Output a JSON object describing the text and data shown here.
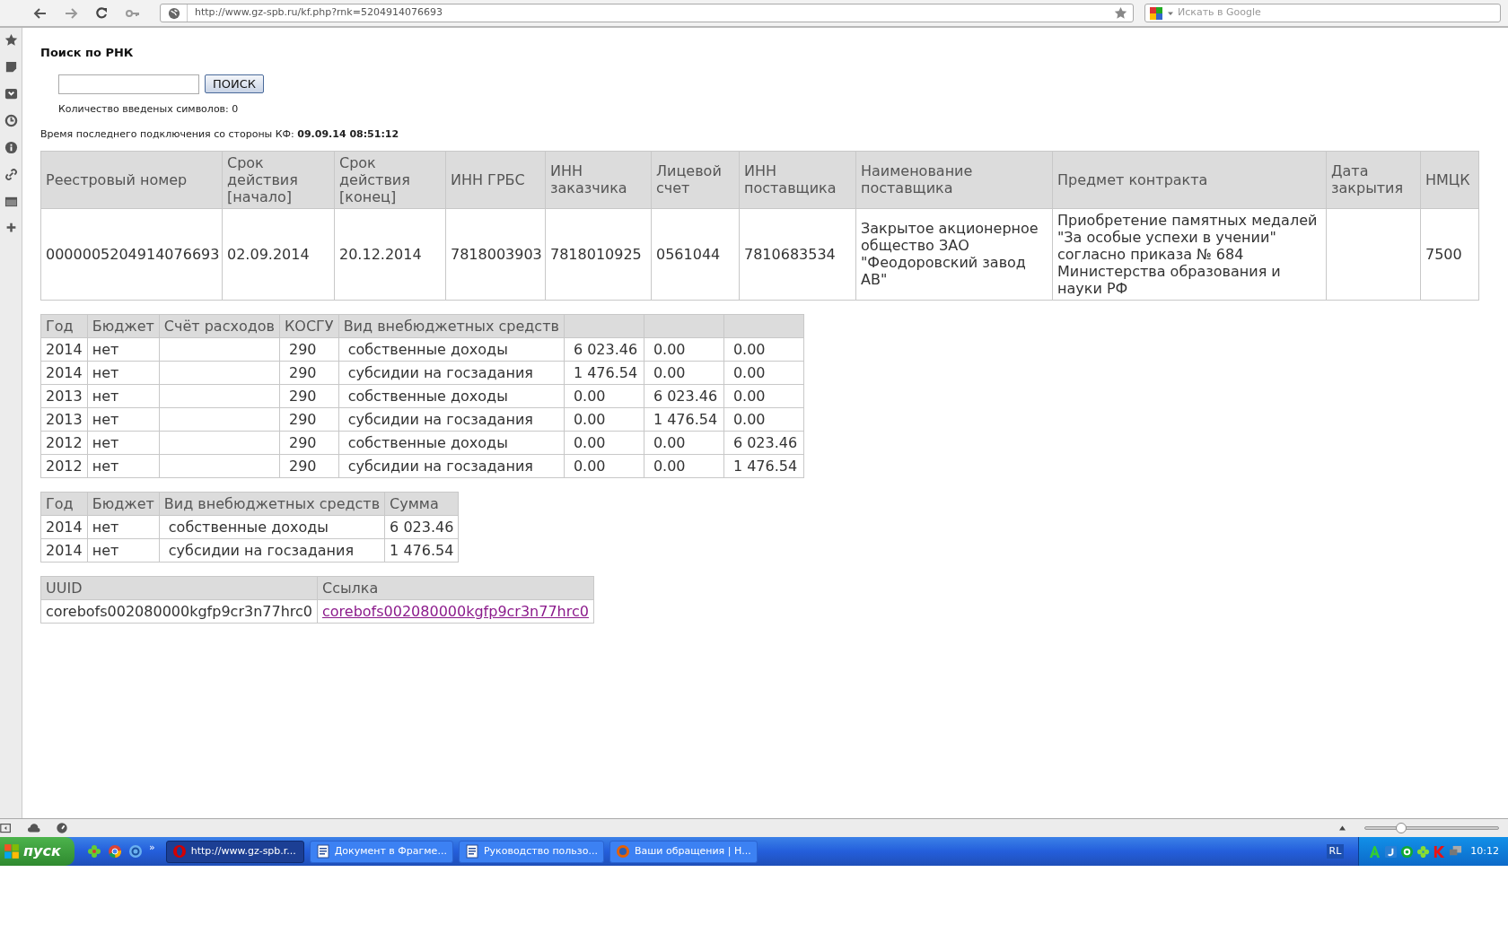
{
  "browser": {
    "url": "http://www.gz-spb.ru/kf.php?rnk=5204914076693",
    "search_placeholder": "Искать в Google",
    "zoom": {
      "level": 0.27
    }
  },
  "page": {
    "title": "Поиск по РНК",
    "search_button": "ПОИСК",
    "char_count": "Количество введеных символов: 0",
    "last_connection_label": "Время последнего подключения со стороны КФ:",
    "last_connection_value": "09.09.14 08:51:12"
  },
  "contract_table": {
    "columns": [
      "Реестровый номер",
      "Срок действия [начало]",
      "Срок действия [конец]",
      "ИНН ГРБС",
      "ИНН заказчика",
      "Лицевой счет",
      "ИНН поставщика",
      "Наименование поставщика",
      "Предмет контракта",
      "Дата закрытия",
      "НМЦК"
    ],
    "row": {
      "registry_number": "0000005204914076693",
      "start": "02.09.2014",
      "end": "20.12.2014",
      "inn_grbs": "7818003903",
      "inn_customer": "7818010925",
      "account": "0561044",
      "inn_supplier": "7810683534",
      "supplier": "Закрытое акционерное общество ЗАО \"Феодоровский завод АВ\"",
      "subject": "Приобретение памятных медалей \"За особые успехи в учении\" согласно приказа № 684 Министерства образования и науки РФ",
      "nmck": "7500"
    }
  },
  "funding_table": {
    "columns": [
      "Год",
      "Бюджет",
      "Счёт расходов",
      "КОСГУ",
      "Вид внебюджетных средств"
    ],
    "rows": [
      {
        "year": "2014",
        "budget": "нет",
        "kosgu": "290",
        "funds": "собственные доходы",
        "values": [
          "6 023.46",
          "0.00",
          "0.00"
        ]
      },
      {
        "year": "2014",
        "budget": "нет",
        "kosgu": "290",
        "funds": "субсидии на госзадания",
        "values": [
          "1 476.54",
          "0.00",
          "0.00"
        ]
      },
      {
        "year": "2013",
        "budget": "нет",
        "kosgu": "290",
        "funds": "собственные доходы",
        "values": [
          "0.00",
          "6 023.46",
          "0.00"
        ]
      },
      {
        "year": "2013",
        "budget": "нет",
        "kosgu": "290",
        "funds": "субсидии на госзадания",
        "values": [
          "0.00",
          "1 476.54",
          "0.00"
        ]
      },
      {
        "year": "2012",
        "budget": "нет",
        "kosgu": "290",
        "funds": "собственные доходы",
        "values": [
          "0.00",
          "0.00",
          "6 023.46"
        ]
      },
      {
        "year": "2012",
        "budget": "нет",
        "kosgu": "290",
        "funds": "субсидии на госзадания",
        "values": [
          "0.00",
          "0.00",
          "1 476.54"
        ]
      }
    ]
  },
  "sum_table": {
    "columns": [
      "Год",
      "Бюджет",
      "Вид внебюджетных средств",
      "Сумма"
    ],
    "rows": [
      [
        "2014",
        "нет",
        "собственные доходы",
        "6 023.46"
      ],
      [
        "2014",
        "нет",
        "субсидии на госзадания",
        "1 476.54"
      ]
    ]
  },
  "uuid_table": {
    "columns": [
      "UUID",
      "Ссылка"
    ],
    "rows": [
      {
        "uuid": "corebofs002080000kgfp9cr3n77hrc0",
        "link": "corebofs002080000kgfp9cr3n77hrc0"
      }
    ]
  },
  "taskbar": {
    "start": "пуск",
    "more": "»",
    "tasks": [
      {
        "kind": "opera",
        "label": "http://www.gz-spb.r...",
        "selected": true
      },
      {
        "kind": "word",
        "label": "Документ в Фрагме...",
        "selected": false
      },
      {
        "kind": "word",
        "label": "Руководство пользо...",
        "selected": false
      },
      {
        "kind": "firefox",
        "label": "Ваши обращения | Н...",
        "selected": false
      }
    ],
    "language": "RL",
    "clock": "10:12"
  }
}
